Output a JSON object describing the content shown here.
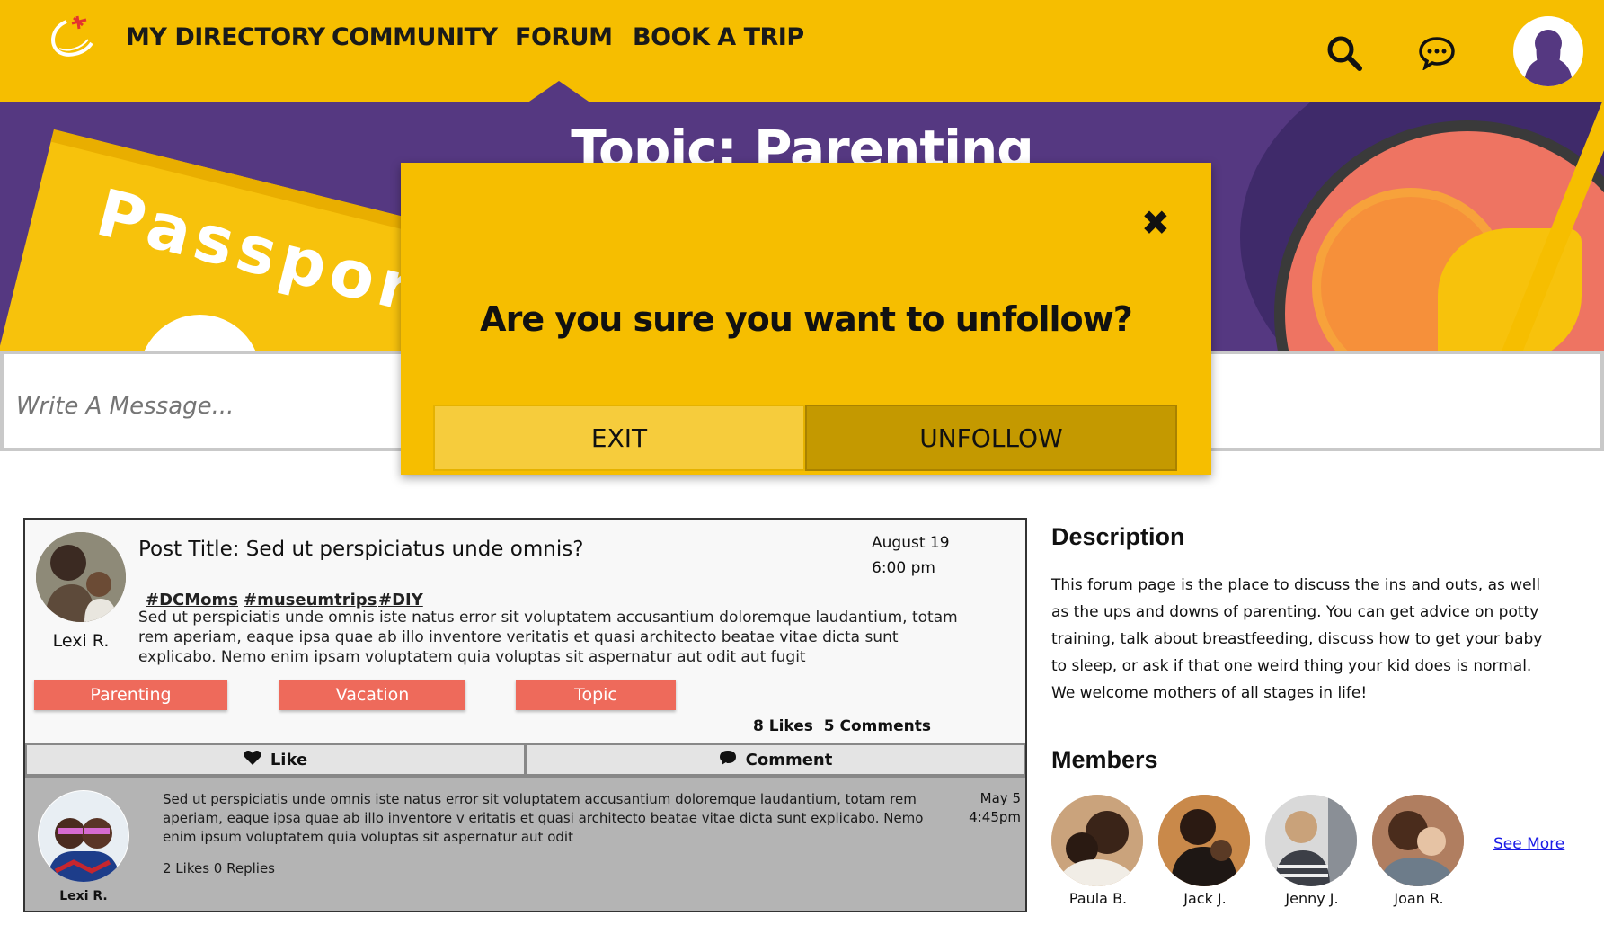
{
  "nav": {
    "items": [
      "MY DIRECTORY",
      "COMMUNITY",
      "FORUM",
      "BOOK A TRIP"
    ],
    "active": "FORUM"
  },
  "banner": {
    "title": "Topic: Parenting",
    "passport_text": "Passport"
  },
  "composer": {
    "placeholder": "Write A Message..."
  },
  "modal": {
    "question": "Are you sure you want to unfollow?",
    "exit_label": "EXIT",
    "unfollow_label": "UNFOLLOW",
    "close_glyph": "✖"
  },
  "post": {
    "title": "Post Title: Sed ut perspiciatus unde omnis?",
    "date": "August 19",
    "time": "6:00 pm",
    "author": "Lexi R.",
    "tags": [
      "#DCMoms",
      "#museumtrips",
      "#DIY"
    ],
    "body": "Sed ut perspiciatis unde omnis iste natus error sit voluptatem accusantium doloremque laudantium, totam rem aperiam, eaque ipsa quae ab illo inventore veritatis et quasi architecto beatae vitae dicta sunt explicabo. Nemo enim ipsam voluptatem quia voluptas sit aspernatur aut odit aut fugit",
    "categories": [
      "Parenting",
      "Vacation",
      "Topic"
    ],
    "likes_text": "8 Likes",
    "comments_text": "5 Comments",
    "like_label": "Like",
    "comment_label": "Comment"
  },
  "reply": {
    "author": "Lexi R.",
    "body": "Sed ut perspiciatis unde omnis iste natus error sit voluptatem accusantium doloremque laudantium, totam rem aperiam, eaque ipsa quae ab illo inventore v eritatis et quasi architecto beatae vitae dicta sunt explicabo. Nemo enim ipsum voluptatem quia voluptas sit aspernatur aut odit",
    "date": "May 5",
    "time": "4:45pm",
    "stats": "2 Likes 0 Replies"
  },
  "sidebar": {
    "description_heading": "Description",
    "description": "This forum page is the place to discuss the ins and outs, as well as the ups and downs of parenting. You can get advice on potty training, talk about breastfeeding, discuss how to get your baby to sleep, or ask if that one weird thing your kid does is normal. We welcome mothers of all stages in life!",
    "members_heading": "Members",
    "members": [
      "Paula B.",
      "Jack J.",
      "Jenny J.",
      "Joan R."
    ],
    "see_more": "See More"
  },
  "colors": {
    "brand_yellow": "#F6BE00",
    "brand_purple": "#553881",
    "accent_coral": "#EE6A5B",
    "link_blue": "#1a1ae6"
  },
  "icons": [
    "logo-icon",
    "search-icon",
    "chat-icon",
    "user-avatar-icon",
    "close-icon",
    "heart-icon",
    "comment-icon"
  ]
}
